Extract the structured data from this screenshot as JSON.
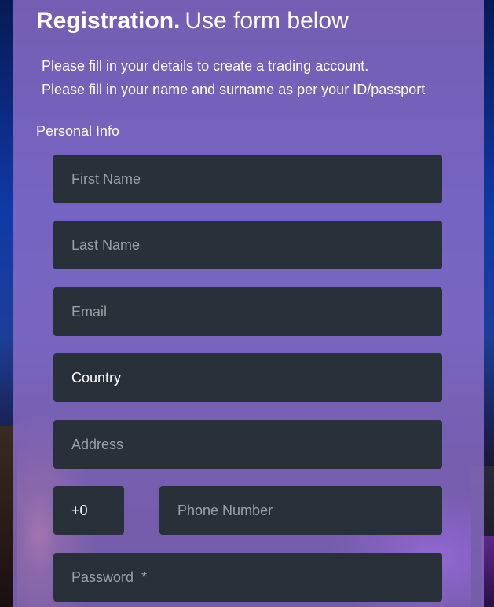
{
  "header": {
    "title_bold": "Registration.",
    "title_rest": "Use form below"
  },
  "intro": {
    "line1": "Please fill in your details to create a trading account.",
    "line2": "Please fill in your name and surname as per your ID/passport"
  },
  "section": {
    "personal_info": "Personal Info"
  },
  "form": {
    "first_name_placeholder": "First Name",
    "last_name_placeholder": "Last Name",
    "email_placeholder": "Email",
    "country_value": "Country",
    "address_placeholder": "Address",
    "phone_code_value": "+0",
    "phone_placeholder": "Phone Number",
    "password_placeholder": "Password  *"
  },
  "colors": {
    "panel": "#8c6ec8",
    "field_bg": "#283139",
    "placeholder": "#9aa0a6",
    "text": "#ffffff"
  }
}
